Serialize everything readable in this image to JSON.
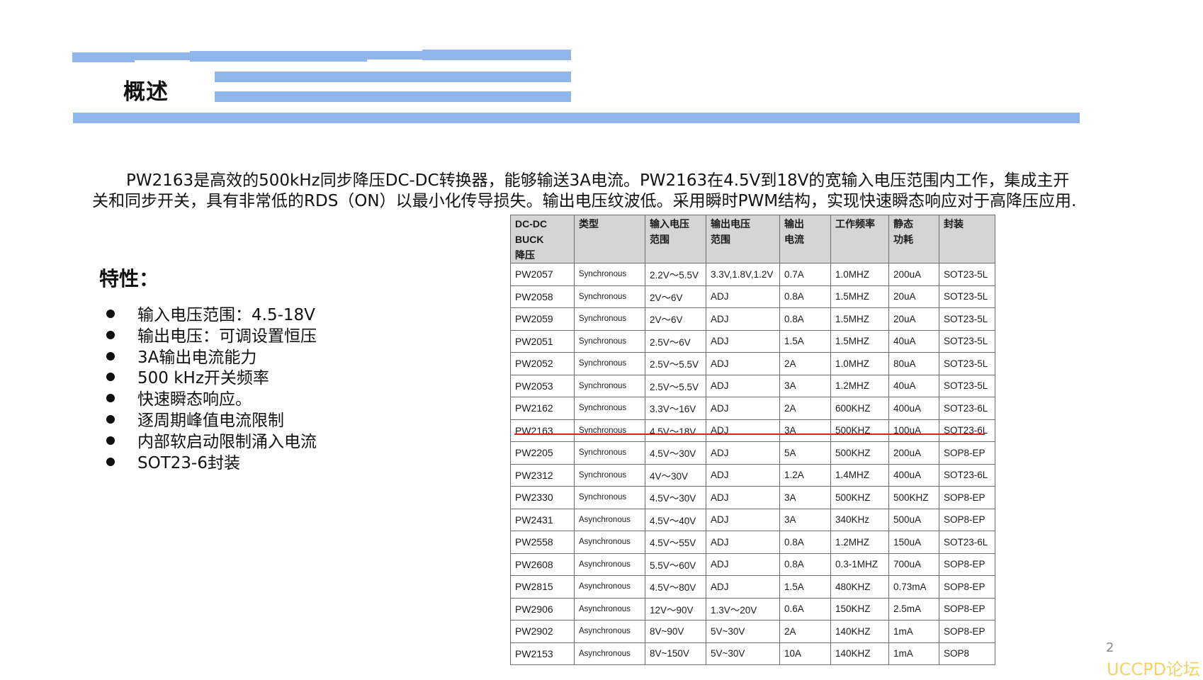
{
  "title": "概述",
  "intro": "PW2163是高效的500kHz同步降压DC-DC转换器，能够输送3A电流。PW2163在4.5V到18V的宽输入电压范围内工作，集成主开关和同步开关，具有非常低的RDS（ON）以最小化传导损失。输出电压纹波低。采用瞬时PWM结构，实现快速瞬态响应对于高降压应用.",
  "features": {
    "title": "特性：",
    "items": [
      "输入电压范围：4.5-18V",
      "输出电压：可调设置恒压",
      "3A输出电流能力",
      "500 kHz开关频率",
      "快速瞬态响应。",
      "逐周期峰值电流限制",
      "内部软启动限制涌入电流",
      "SOT23-6封装"
    ]
  },
  "table": {
    "headers": [
      [
        "DC-DC",
        "BUCK",
        "降压"
      ],
      [
        "类型"
      ],
      [
        "输入电压",
        "范围"
      ],
      [
        "输出电压",
        "范围"
      ],
      [
        "输出",
        "电流"
      ],
      [
        "工作频率"
      ],
      [
        "静态",
        "功耗"
      ],
      [
        "封装"
      ]
    ],
    "rows": [
      [
        "PW2057",
        "Synchronous",
        "2.2V～5.5V",
        "3.3V,1.8V,1.2V",
        "0.7A",
        "1.0MHZ",
        "200uA",
        "SOT23-5L"
      ],
      [
        "PW2058",
        "Synchronous",
        "2V～6V",
        "ADJ",
        "0.8A",
        "1.5MHZ",
        "20uA",
        "SOT23-5L"
      ],
      [
        "PW2059",
        "Synchronous",
        "2V～6V",
        "ADJ",
        "0.8A",
        "1.5MHZ",
        "20uA",
        "SOT23-5L"
      ],
      [
        "PW2051",
        "Synchronous",
        "2.5V～6V",
        "ADJ",
        "1.5A",
        "1.5MHZ",
        "40uA",
        "SOT23-5L"
      ],
      [
        "PW2052",
        "Synchronous",
        "2.5V～5.5V",
        "ADJ",
        "2A",
        "1.0MHZ",
        "80uA",
        "SOT23-5L"
      ],
      [
        "PW2053",
        "Synchronous",
        "2.5V～5.5V",
        "ADJ",
        "3A",
        "1.2MHZ",
        "40uA",
        "SOT23-5L"
      ],
      [
        "PW2162",
        "Synchronous",
        "3.3V～16V",
        "ADJ",
        "2A",
        "600KHZ",
        "400uA",
        "SOT23-6L"
      ],
      [
        "PW2163",
        "Synchronous",
        "4.5V～18V",
        "ADJ",
        "3A",
        "500KHZ",
        "100uA",
        "SOT23-6L"
      ],
      [
        "PW2205",
        "Synchronous",
        "4.5V～30V",
        "ADJ",
        "5A",
        "500KHZ",
        "200uA",
        "SOP8-EP"
      ],
      [
        "PW2312",
        "Synchronous",
        "4V～30V",
        "ADJ",
        "1.2A",
        "1.4MHZ",
        "400uA",
        "SOT23-6L"
      ],
      [
        "PW2330",
        "Synchronous",
        "4.5V～30V",
        "ADJ",
        "3A",
        "500KHZ",
        "500KHZ",
        "SOP8-EP"
      ],
      [
        "PW2431",
        "Asynchronous",
        "4.5V～40V",
        "ADJ",
        "3A",
        "340KHz",
        "500uA",
        "SOP8-EP"
      ],
      [
        "PW2558",
        "Asynchronous",
        "4.5V～55V",
        "ADJ",
        "0.8A",
        "1.2MHZ",
        "150uA",
        "SOT23-6L"
      ],
      [
        "PW2608",
        "Asynchronous",
        "5.5V～60V",
        "ADJ",
        "0.8A",
        "0.3-1MHZ",
        "700uA",
        "SOP8-EP"
      ],
      [
        "PW2815",
        "Asynchronous",
        "4.5V～80V",
        "ADJ",
        "1.5A",
        "480KHZ",
        "0.73mA",
        "SOP8-EP"
      ],
      [
        "PW2906",
        "Asynchronous",
        "12V～90V",
        "1.3V～20V",
        "0.6A",
        "150KHZ",
        "2.5mA",
        "SOP8-EP"
      ],
      [
        "PW2902",
        "Asynchronous",
        "8V~90V",
        "5V~30V",
        "2A",
        "140KHZ",
        "1mA",
        "SOP8-EP"
      ],
      [
        "PW2153",
        "Asynchronous",
        "8V~150V",
        "5V~30V",
        "10A",
        "140KHZ",
        "1mA",
        "SOP8"
      ]
    ],
    "highlighted_model": "PW2163",
    "highlight_color": "#e02020"
  },
  "page_number": "2",
  "watermark": "UCCPD论坛",
  "colors": {
    "bar": "#8fb6ea",
    "header_bg": "#d5d5d5",
    "watermark": "#f2d26a"
  }
}
